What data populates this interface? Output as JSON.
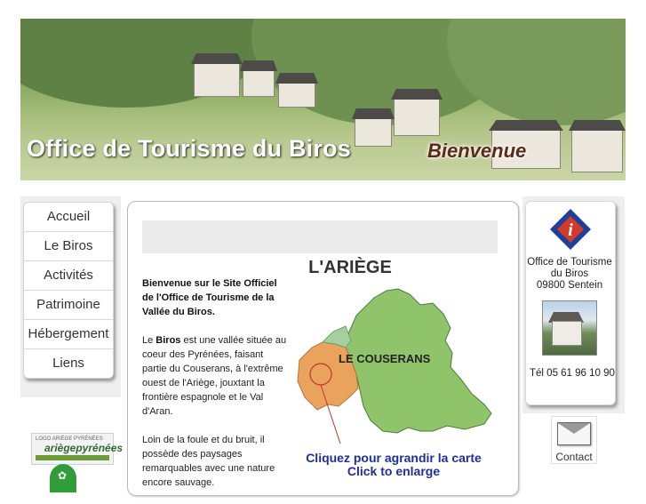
{
  "banner": {
    "title": "Office de Tourisme du Biros",
    "subtitle": "Bienvenue"
  },
  "nav": {
    "items": [
      {
        "label": "Accueil"
      },
      {
        "label": "Le Biros"
      },
      {
        "label": "Activités"
      },
      {
        "label": "Patrimoine"
      },
      {
        "label": "Hébergement"
      },
      {
        "label": "Liens"
      }
    ]
  },
  "logos": {
    "ariege_small": "LOGO ARIÈGE PYRÉNÉES",
    "ariege_main": "ariègepyrénées"
  },
  "content": {
    "p1": "Bienvenue sur le Site Officiel de l'Office de Tourisme de la Vallée du Biros.",
    "p2_pre": "Le ",
    "p2_bold": "Biros",
    "p2_post": " est une vallée située au coeur des Pyrénées, faisant partie du Couserans, à l'extrême ouest de l'Ariège, jouxtant la frontière espagnole et le Val d'Aran.",
    "p3": "Loin de la foule et du bruit, il possède des paysages remarquables avec une nature encore sauvage."
  },
  "map": {
    "title": "L'ARIÈGE",
    "region_label": "LE COUSERANS",
    "caption_fr": "Cliquez pour agrandir la carte",
    "caption_en": "Click to enlarge"
  },
  "right": {
    "name_line1": "Office de Tourisme",
    "name_line2": "du Biros",
    "name_line3": "09800 Sentein",
    "tel": "Tél   05 61 96 10 90"
  },
  "contact": {
    "label": "Contact"
  },
  "colors": {
    "accent_blue": "#1f2f9a",
    "map_green": "#8fc46b",
    "map_orange": "#e9a35c"
  }
}
